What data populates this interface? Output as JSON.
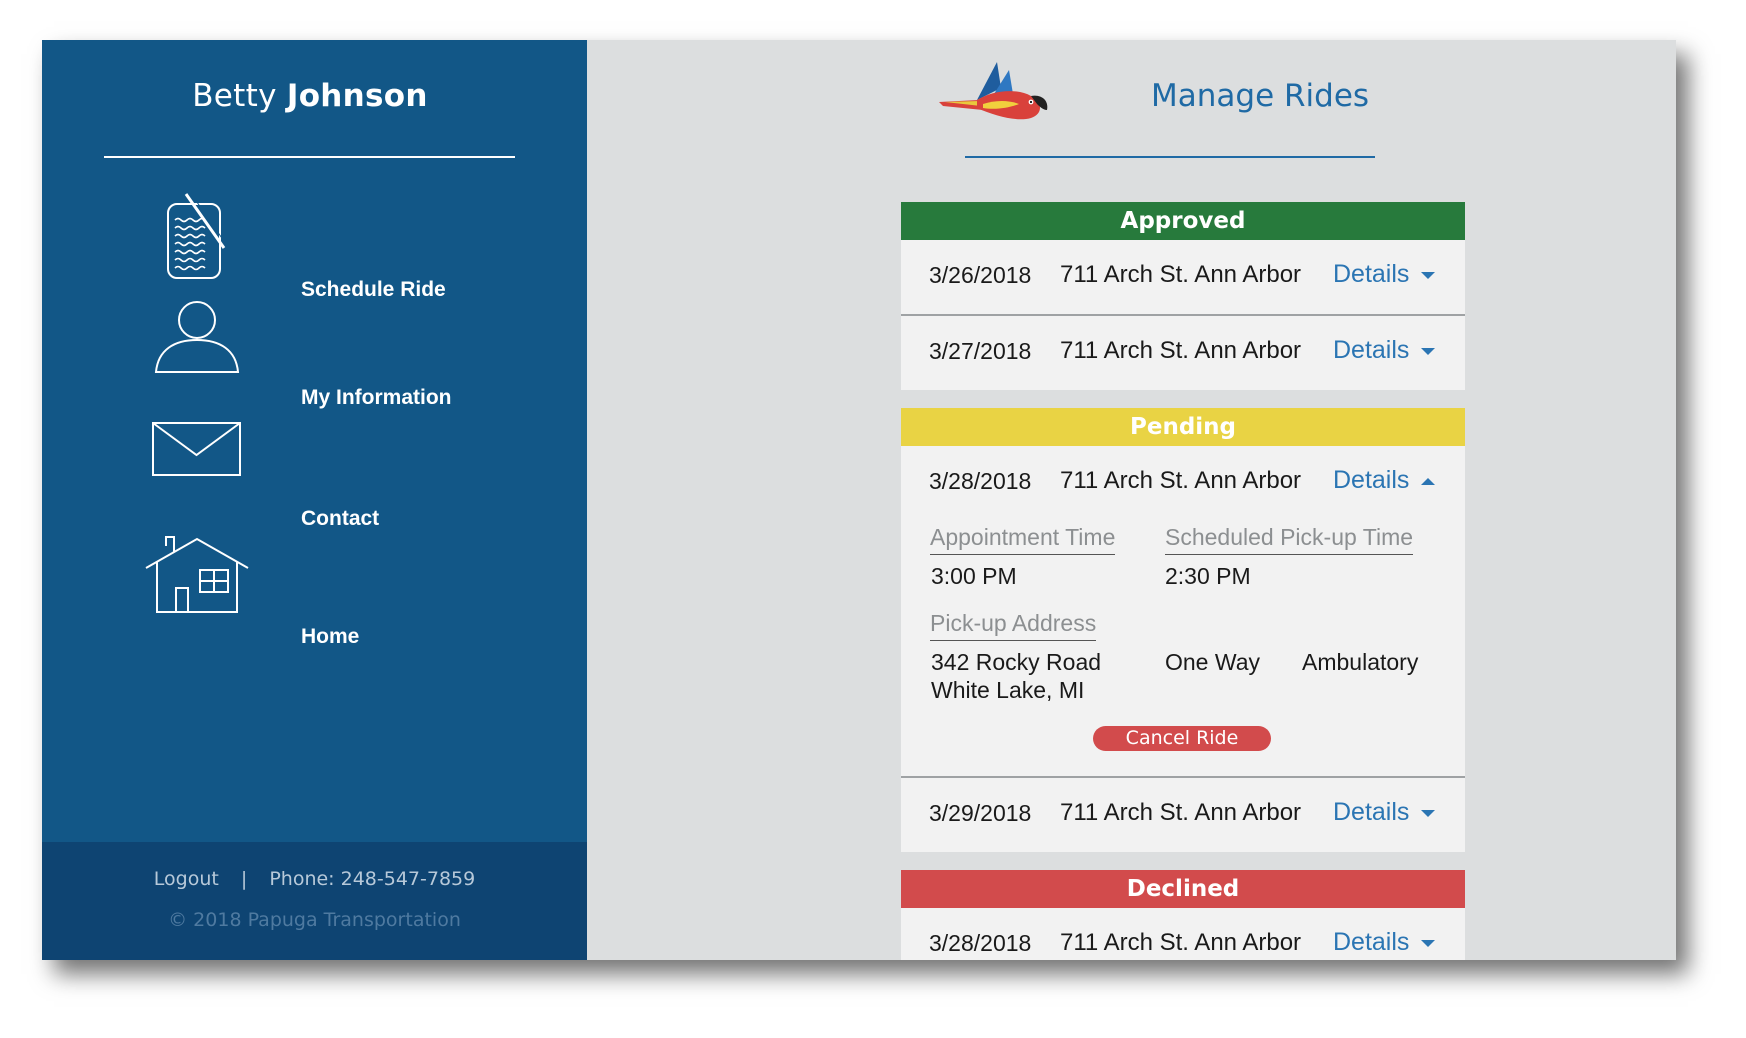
{
  "user": {
    "first_name": "Betty",
    "last_name": "Johnson"
  },
  "nav": [
    {
      "label": "Schedule Ride",
      "icon": "clipboard-pen-icon"
    },
    {
      "label": "My Information",
      "icon": "person-icon"
    },
    {
      "label": "Contact",
      "icon": "envelope-icon"
    },
    {
      "label": "Home",
      "icon": "house-icon"
    }
  ],
  "footer": {
    "logout": "Logout",
    "separator": "|",
    "phone": "Phone: 248-547-7859",
    "copyright": "© 2018 Papuga Transportation"
  },
  "header": {
    "title": "Manage Rides",
    "logo_icon": "parrot-logo-icon"
  },
  "colors": {
    "sidebar": "#125787",
    "approved": "#277a3c",
    "pending": "#e9d344",
    "declined": "#d24b4c",
    "accent": "#1f6aa5"
  },
  "sections": {
    "approved": {
      "label": "Approved",
      "rides": [
        {
          "date": "3/26/2018",
          "address": "711 Arch St. Ann Arbor",
          "details": "Details"
        },
        {
          "date": "3/27/2018",
          "address": "711 Arch St. Ann Arbor",
          "details": "Details"
        }
      ]
    },
    "pending": {
      "label": "Pending",
      "expanded_ride": {
        "date": "3/28/2018",
        "address": "711 Arch St. Ann Arbor",
        "details": "Details",
        "appointment_label": "Appointment Time",
        "appointment_value": "3:00 PM",
        "pickup_time_label": "Scheduled Pick-up Time",
        "pickup_time_value": "2:30 PM",
        "pickup_address_label": "Pick-up Address",
        "pickup_address_line1": "342 Rocky Road",
        "pickup_address_line2": "White Lake, MI",
        "trip_type": "One Way",
        "mobility": "Ambulatory",
        "cancel_label": "Cancel Ride"
      },
      "rides": [
        {
          "date": "3/29/2018",
          "address": "711 Arch St. Ann Arbor",
          "details": "Details"
        }
      ]
    },
    "declined": {
      "label": "Declined",
      "rides": [
        {
          "date": "3/28/2018",
          "address": "711 Arch St. Ann Arbor",
          "details": "Details"
        }
      ]
    }
  }
}
